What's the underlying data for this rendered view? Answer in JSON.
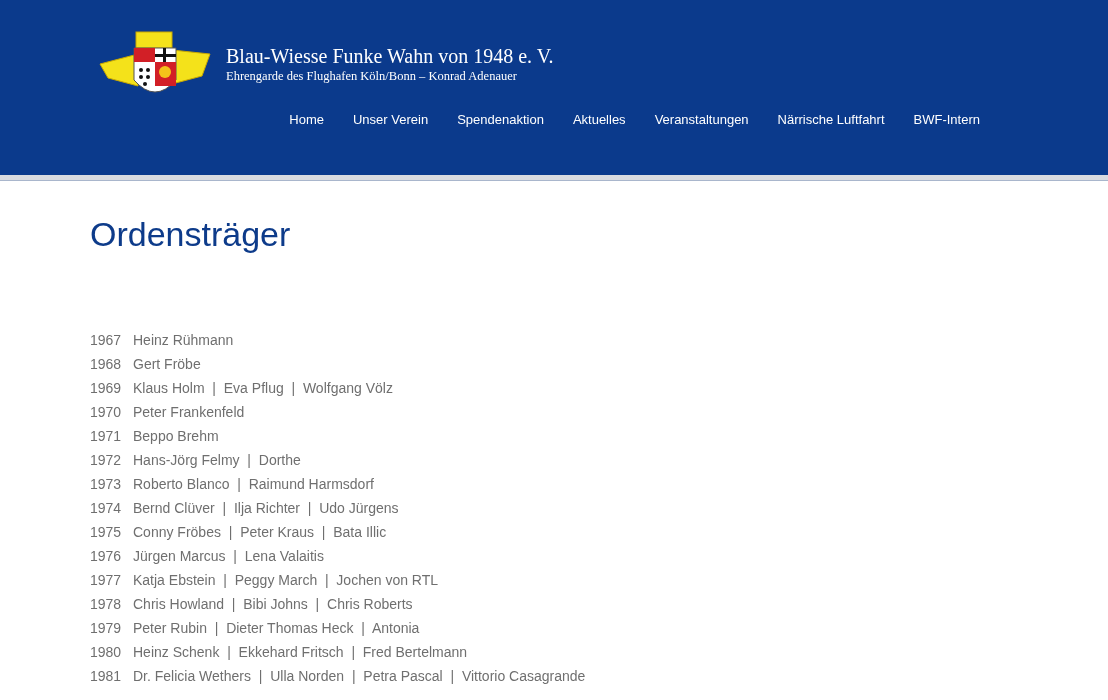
{
  "header": {
    "title": "Blau-Wiesse Funke Wahn von 1948 e. V.",
    "subtitle": "Ehrengarde des Flughafen Köln/Bonn – Konrad Adenauer"
  },
  "nav": [
    {
      "label": "Home"
    },
    {
      "label": "Unser Verein"
    },
    {
      "label": "Spendenaktion"
    },
    {
      "label": "Aktuelles"
    },
    {
      "label": "Veranstaltungen"
    },
    {
      "label": "Närrische Luftfahrt"
    },
    {
      "label": "BWF-Intern"
    }
  ],
  "page_title": "Ordensträger",
  "rows": [
    {
      "year": "1967",
      "names": "Heinz Rühmann"
    },
    {
      "year": "1968",
      "names": "Gert Fröbe"
    },
    {
      "year": "1969",
      "names": "Klaus Holm  |  Eva Pflug  |  Wolfgang Völz"
    },
    {
      "year": "1970",
      "names": "Peter Frankenfeld"
    },
    {
      "year": "1971",
      "names": "Beppo Brehm"
    },
    {
      "year": "1972",
      "names": "Hans-Jörg Felmy  |  Dorthe"
    },
    {
      "year": "1973",
      "names": "Roberto Blanco  |  Raimund Harmsdorf"
    },
    {
      "year": "1974",
      "names": "Bernd Clüver  |  Ilja Richter  |  Udo Jürgens"
    },
    {
      "year": "1975",
      "names": "Conny Fröbes  |  Peter Kraus  |  Bata Illic"
    },
    {
      "year": "1976",
      "names": "Jürgen Marcus  |  Lena Valaitis"
    },
    {
      "year": "1977",
      "names": "Katja Ebstein  |  Peggy March  |  Jochen von RTL"
    },
    {
      "year": "1978",
      "names": "Chris Howland  |  Bibi Johns  |  Chris Roberts"
    },
    {
      "year": "1979",
      "names": "Peter Rubin  |  Dieter Thomas Heck  |  Antonia"
    },
    {
      "year": "1980",
      "names": "Heinz Schenk  |  Ekkehard Fritsch  |  Fred Bertelmann"
    },
    {
      "year": "1981",
      "names": "Dr. Felicia Wethers  |  Ulla Norden  |  Petra Pascal  |  Vittorio Casagrande"
    }
  ]
}
